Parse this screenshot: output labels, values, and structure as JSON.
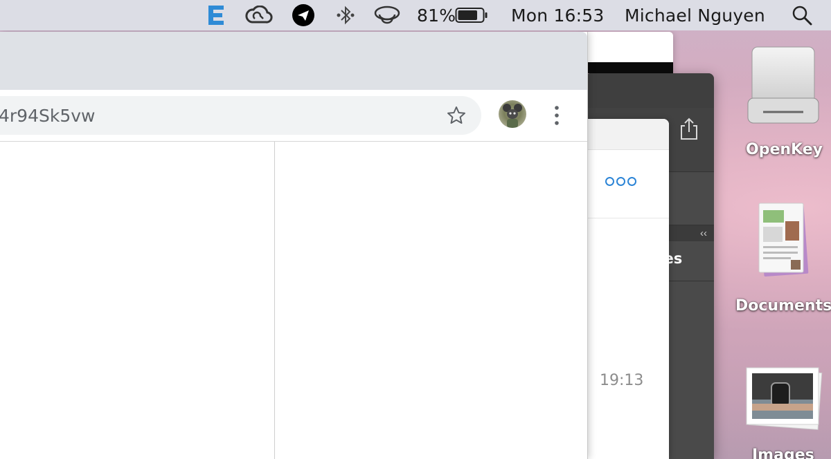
{
  "menubar": {
    "clock": "Mon 16:53",
    "user_name": "Michael Nguyen",
    "battery_percent": "81%",
    "battery_level": 0.81,
    "status_icons": [
      "evernote-icon",
      "creative-cloud-icon",
      "telegram-icon",
      "bluetooth-icon",
      "airplay-icon",
      "battery-icon",
      "spotlight-search-icon"
    ]
  },
  "browser": {
    "address_text": "4r94Sk5vw"
  },
  "back_windows": {
    "time_label": "19:13",
    "partial_label": "ries",
    "collapse_label": "‹‹"
  },
  "desktop": {
    "icons": [
      {
        "label": "OpenKey",
        "icon": "external-drive-icon"
      },
      {
        "label": "Documents",
        "icon": "documents-folder-icon"
      },
      {
        "label": "Images",
        "icon": "images-folder-icon"
      }
    ]
  },
  "colors": {
    "menubar_bg": "#dcdde5",
    "tabstrip_bg": "#dee1e6",
    "omnibox_bg": "#f1f3f4",
    "accent_blue": "#2b84d6",
    "evernote_blue": "#2f8bd6"
  }
}
